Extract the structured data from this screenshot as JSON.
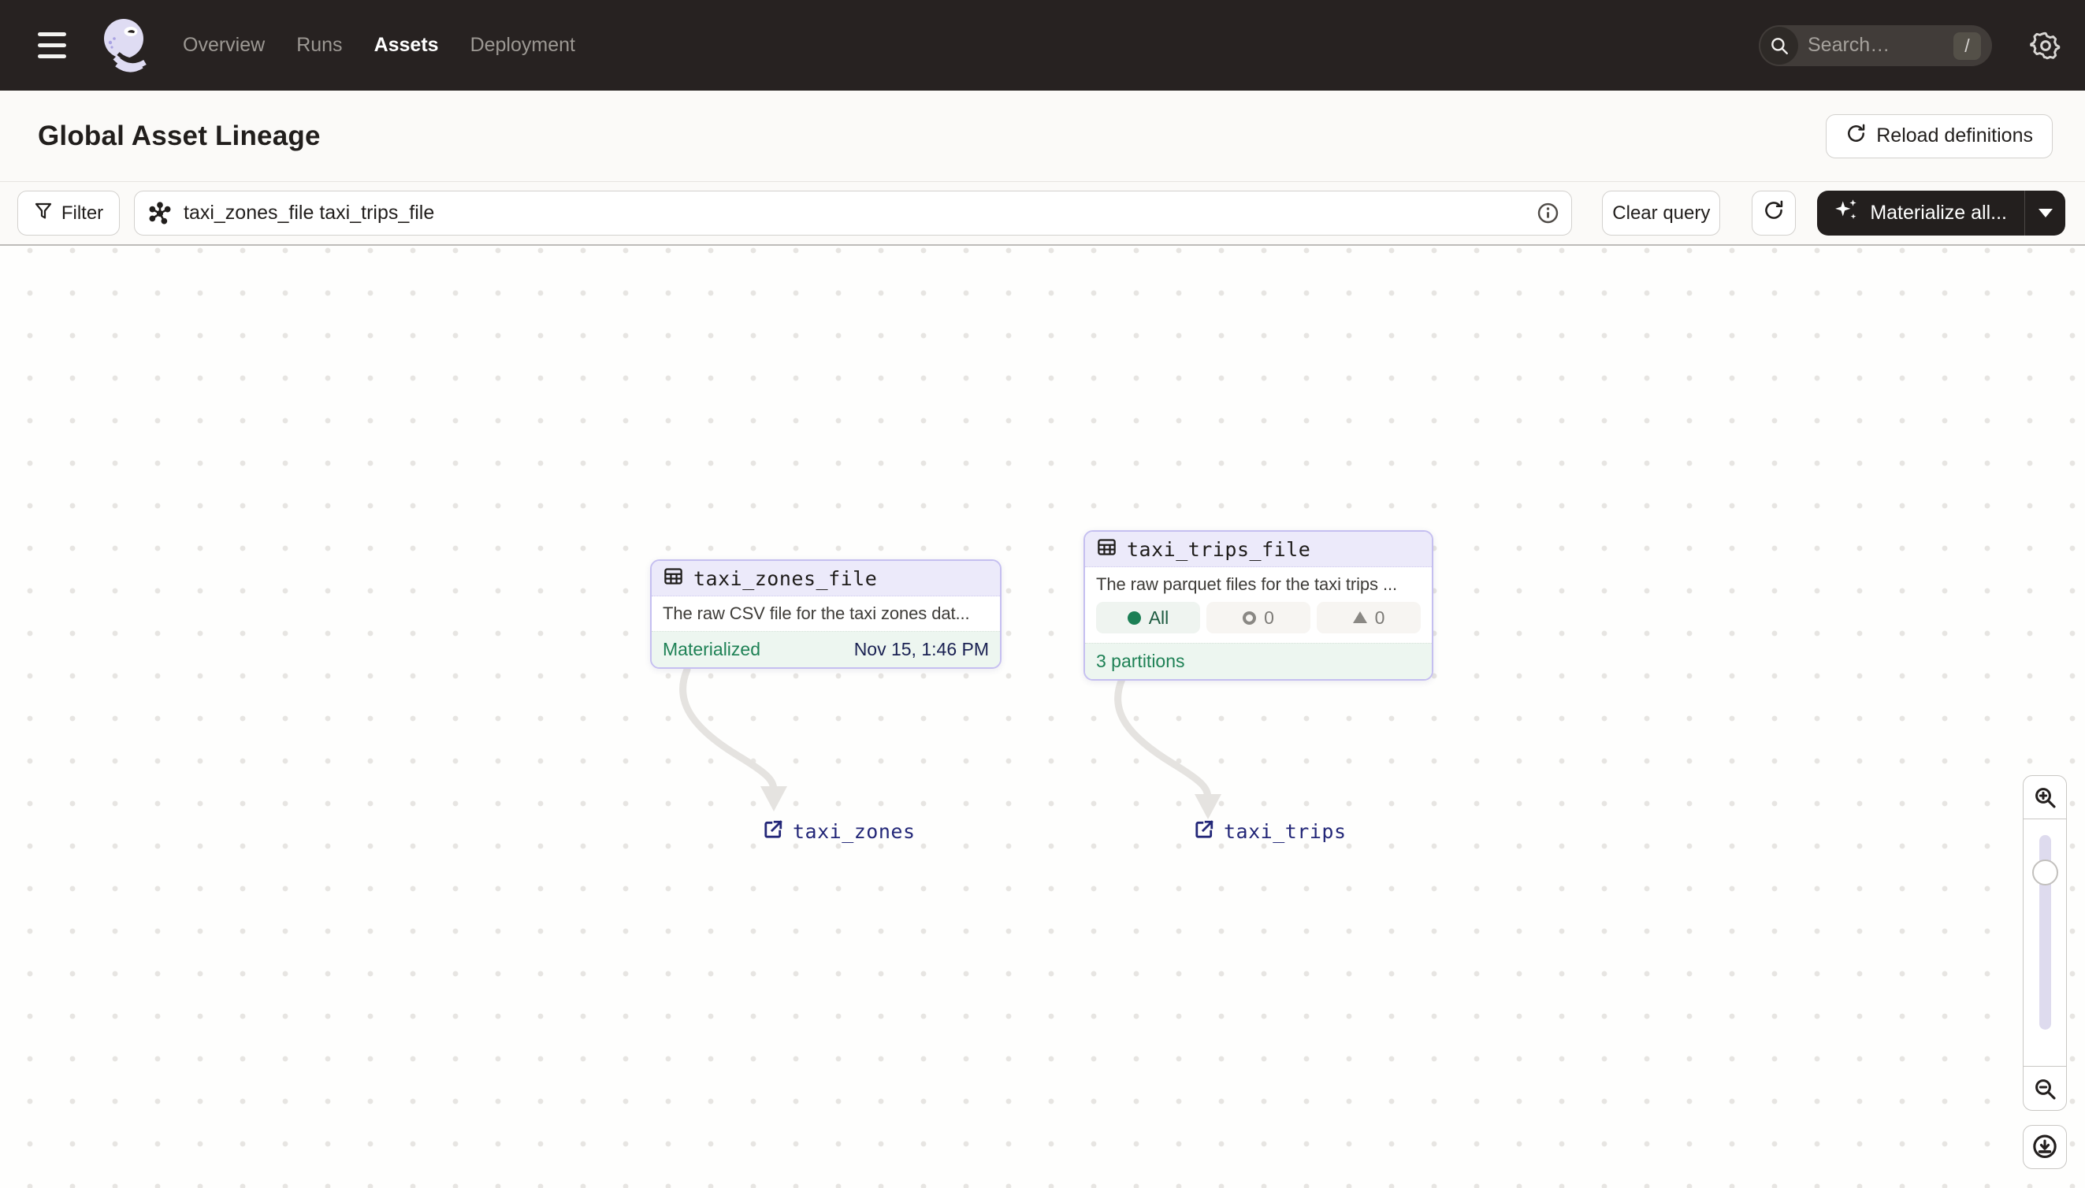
{
  "nav": {
    "menu_items": [
      {
        "label": "Overview",
        "active": false
      },
      {
        "label": "Runs",
        "active": false
      },
      {
        "label": "Assets",
        "active": true
      },
      {
        "label": "Deployment",
        "active": false
      }
    ],
    "search": {
      "placeholder": "Search…",
      "shortcut": "/"
    }
  },
  "header": {
    "title": "Global Asset Lineage",
    "reload_button_label": "Reload definitions"
  },
  "toolbar": {
    "filter_button_label": "Filter",
    "query_value": "taxi_zones_file taxi_trips_file",
    "clear_button_label": "Clear query",
    "materialize_button_label": "Materialize all..."
  },
  "graph": {
    "nodes": [
      {
        "title": "taxi_zones_file",
        "description": "The raw CSV file for the taxi zones dat...",
        "status": "Materialized",
        "timestamp": "Nov 15, 1:46 PM"
      },
      {
        "title": "taxi_trips_file",
        "description": "The raw parquet files for the taxi trips ...",
        "badges": [
          {
            "icon": "materialized-dot",
            "label": "All"
          },
          {
            "icon": "missing-ring",
            "label": "0"
          },
          {
            "icon": "stale-triangle",
            "label": "0"
          }
        ],
        "footer": "3 partitions"
      }
    ],
    "external_links": [
      {
        "label": "taxi_zones"
      },
      {
        "label": "taxi_trips"
      }
    ]
  },
  "colors": {
    "nav_background": "#272221",
    "accent_green": "#1E8155",
    "node_header_lavender": "#ECEAFA",
    "node_border_lavender": "#C5BFF0",
    "link_navy": "#232778",
    "timestamp_navy": "#1A2152",
    "dark_button": "#231F1E"
  }
}
